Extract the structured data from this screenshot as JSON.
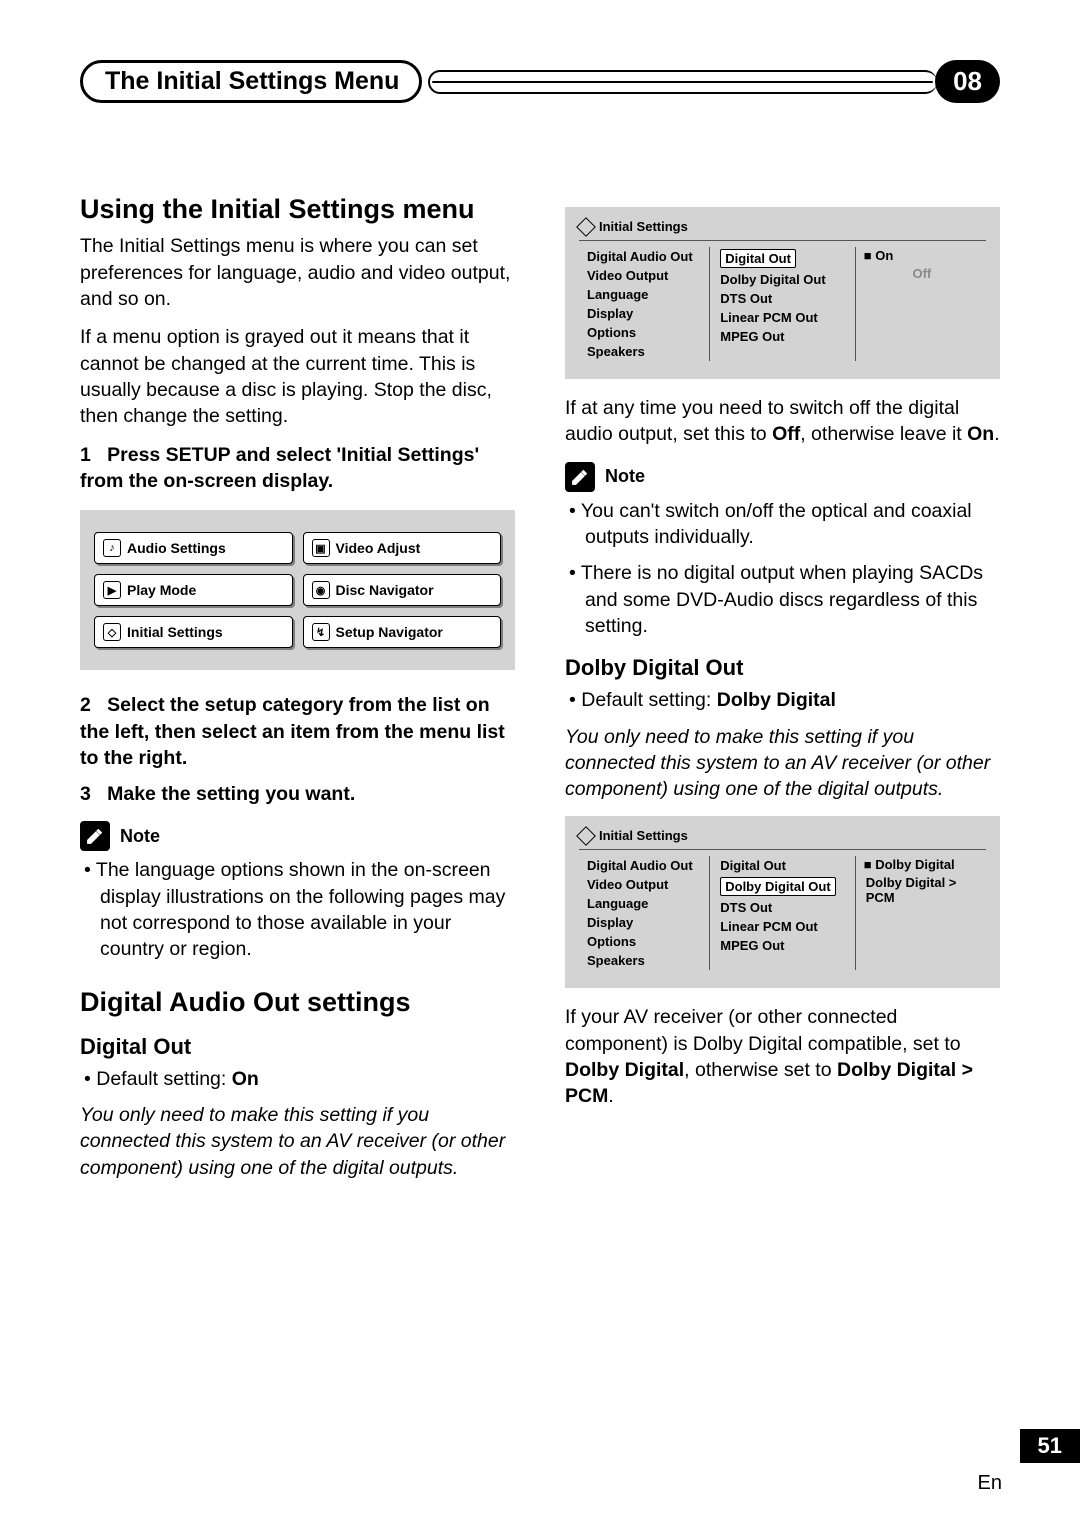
{
  "header": {
    "chapter_title": "The Initial Settings Menu",
    "chapter_number_badge": "08"
  },
  "left": {
    "h1": "Using the Initial Settings menu",
    "intro1": "The Initial Settings menu is where you can set preferences for language, audio and video output, and so on.",
    "intro2": "If a menu option is grayed out it means that it cannot be changed at the current time. This is usually because a disc is playing. Stop the disc, then change the setting.",
    "step1_num": "1",
    "step1_bold": "Press SETUP and select 'Initial Settings' from the on-screen display.",
    "setup_menu": {
      "b1": "Audio Settings",
      "b2": "Video Adjust",
      "b3": "Play Mode",
      "b4": "Disc Navigator",
      "b5": "Initial Settings",
      "b6": "Setup Navigator"
    },
    "step2_num": "2",
    "step2_bold": "Select the setup category from the list on the left, then select an item from the menu list to the right.",
    "step3_num": "3",
    "step3_bold": "Make the setting you want.",
    "note_label": "Note",
    "note_bullet": "The language options shown in the on-screen display illustrations on the following pages may not correspond to those available in your country or region.",
    "h2_digital_audio": "Digital Audio Out settings",
    "h3_digital_out": "Digital Out",
    "digital_out_default_pre": "Default setting: ",
    "digital_out_default_val": "On",
    "digital_out_italic": "You only need to make this setting if you connected this system to an AV receiver (or other component) using one of the digital outputs."
  },
  "right": {
    "osd1": {
      "title": "Initial Settings",
      "cats": [
        "Digital Audio Out",
        "Video Output",
        "Language",
        "Display",
        "Options",
        "Speakers"
      ],
      "items": [
        "Digital Out",
        "Dolby Digital Out",
        "DTS Out",
        "Linear PCM Out",
        "MPEG Out"
      ],
      "selected_item_index": 0,
      "opts": [
        "On",
        "Off"
      ],
      "selected_opt_index": 0
    },
    "para1_pre": "If at any time you need to switch off the digital audio output, set this to ",
    "para1_b1": "Off",
    "para1_mid": ", otherwise leave it ",
    "para1_b2": "On",
    "para1_post": ".",
    "note_label": "Note",
    "note_bullets": [
      "You can't switch on/off the optical and coaxial outputs individually.",
      "There is no digital output when playing SACDs and some DVD-Audio discs regardless of this setting."
    ],
    "h3_dolby": "Dolby Digital Out",
    "dolby_default_pre": "Default setting: ",
    "dolby_default_val": "Dolby Digital",
    "dolby_italic": "You only need to make this setting if you connected this system to an AV receiver (or other component) using one of the digital outputs.",
    "osd2": {
      "title": "Initial Settings",
      "cats": [
        "Digital Audio Out",
        "Video Output",
        "Language",
        "Display",
        "Options",
        "Speakers"
      ],
      "items": [
        "Digital Out",
        "Dolby Digital Out",
        "DTS Out",
        "Linear PCM Out",
        "MPEG Out"
      ],
      "selected_item_index": 1,
      "opts": [
        "Dolby Digital",
        "Dolby Digital > PCM"
      ],
      "selected_opt_index": 0
    },
    "para2_pre": "If your AV receiver (or other connected component) is Dolby Digital compatible, set to ",
    "para2_b1": "Dolby Digital",
    "para2_mid": ", otherwise set to ",
    "para2_b2": "Dolby Digital > PCM",
    "para2_post": "."
  },
  "footer": {
    "page_number": "51",
    "lang": "En"
  }
}
